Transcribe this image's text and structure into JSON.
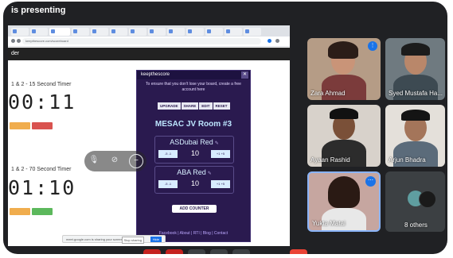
{
  "meeting": {
    "presenting_banner": "is presenting"
  },
  "browser": {
    "address_text": "keepthescore.com/scoreboard",
    "site_header": "der"
  },
  "timers": [
    {
      "label": "1 & 2 - 15 Second Timer",
      "display": "00:11"
    },
    {
      "label": "1 & 2 - 70 Second Timer",
      "display": "01:10"
    }
  ],
  "scoreboard": {
    "brand": "keepthescore",
    "note": "To ensure that you don't lose your board, create a free account here",
    "actions": [
      "UPGRADE",
      "SHARE",
      "EDIT",
      "RESET"
    ],
    "title": "MESAC JV Room #3",
    "teams": [
      {
        "name": "ASDubai Red",
        "score": "10",
        "minus": [
          "-5",
          "-1"
        ],
        "plus": [
          "+1",
          "+5"
        ]
      },
      {
        "name": "ABA Red",
        "score": "10",
        "minus": [
          "-5",
          "-1"
        ],
        "plus": [
          "+1",
          "+5"
        ]
      }
    ],
    "add_counter": "ADD COUNTER",
    "footer": "Facebook | About | RTI | Blog | Contact"
  },
  "share_bar": {
    "text": "meet.google.com is sharing your screen",
    "stop": "Stop sharing",
    "hide": "Hide"
  },
  "participants": [
    {
      "name": "Zara Ahmad"
    },
    {
      "name": "Syed Mustafa Ha..."
    },
    {
      "name": "Ayaan Rashid"
    },
    {
      "name": "Arjun Bhadra"
    },
    {
      "name": "Yukta Matai"
    },
    {
      "name": "8 others"
    }
  ],
  "colors": {
    "meet_bg": "#202124",
    "scoreboard_bg": "#2a1a4f",
    "accent_blue": "#1a73e8"
  }
}
